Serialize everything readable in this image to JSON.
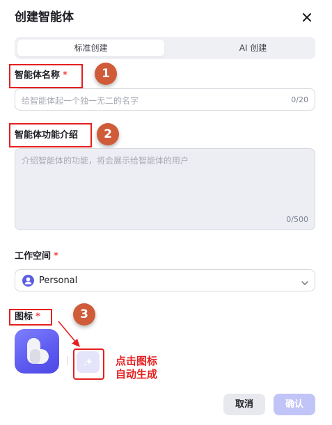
{
  "dialog": {
    "title": "创建智能体",
    "close_icon": "close-icon"
  },
  "tabs": [
    {
      "label": "标准创建",
      "active": true
    },
    {
      "label": "AI 创建",
      "active": false
    }
  ],
  "fields": {
    "name": {
      "label": "智能体名称",
      "required": "*",
      "placeholder": "给智能体起一个独一无二的名字",
      "value": "",
      "counter": "0/20"
    },
    "description": {
      "label": "智能体功能介绍",
      "placeholder": "介绍智能体的功能，将会展示给智能体的用户",
      "value": "",
      "counter": "0/500"
    },
    "workspace": {
      "label": "工作空间",
      "required": "*",
      "selected": "Personal",
      "icon": "user-icon"
    },
    "icon": {
      "label": "图标",
      "required": "*",
      "preview_icon": "agent-logo-icon",
      "generate_icon": "sparkle-icon"
    }
  },
  "annotations": {
    "badges": [
      "1",
      "2",
      "3"
    ],
    "callout_lines": [
      "点击图标",
      "自动生成"
    ],
    "color": "#e51f1f",
    "badge_color": "#cf5b39"
  },
  "footer": {
    "cancel_label": "取消",
    "confirm_label": "确认"
  },
  "colors": {
    "accent": "#5f5cf0",
    "confirm_disabled": "#c1c4f7",
    "required": "#f53f3f"
  }
}
